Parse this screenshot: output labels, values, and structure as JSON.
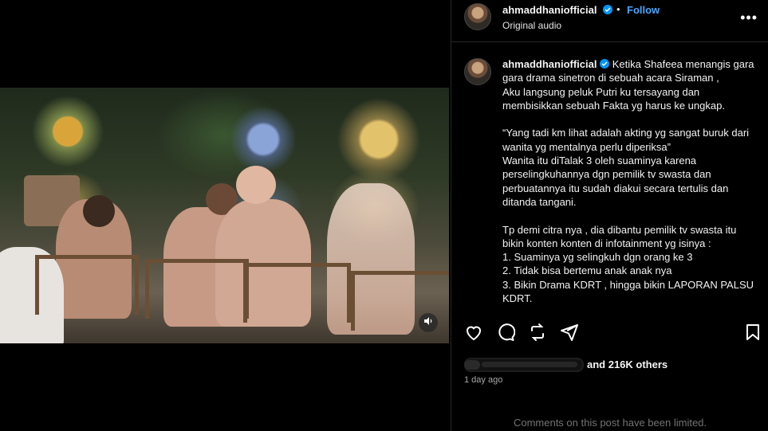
{
  "header": {
    "username": "ahmaddhaniofficial",
    "follow_label": "Follow",
    "audio_label": "Original audio",
    "more_icon": "more-horizontal-icon"
  },
  "caption": {
    "username": "ahmaddhaniofficial",
    "text": "Ketika Shafeea menangis gara gara drama sinetron di sebuah acara Siraman ,\nAku langsung peluk Putri ku tersayang dan membisikkan sebuah Fakta yg harus ke ungkap.\n\n“Yang tadi km lihat adalah akting yg sangat buruk dari wanita yg mentalnya perlu diperiksa”\nWanita itu diTalak 3 oleh suaminya karena perselingkuhannya dgn pemilik tv swasta dan perbuatannya itu sudah diakui secara tertulis dan ditanda tangani.\n\nTp demi citra nya , dia dibantu pemilik tv swasta itu bikin konten konten di infotainment yg isinya :\n1. Suaminya yg selingkuh dgn orang ke 3\n2. Tidak bisa bertemu anak anak nya\n3. Bikin Drama KDRT , hingga bikin LAPORAN PALSU KDRT."
  },
  "actions": {
    "like_icon": "heart-icon",
    "comment_icon": "comment-icon",
    "repost_icon": "repost-icon",
    "share_icon": "send-icon",
    "save_icon": "bookmark-icon"
  },
  "likes": {
    "suffix": "and 216K others"
  },
  "timestamp": "1 day ago",
  "comments_notice": "Comments on this post have been limited.",
  "media": {
    "volume_icon": "volume-icon"
  },
  "colors": {
    "accent": "#0095f6",
    "follow": "#4aa6ff",
    "background": "#000000",
    "muted_text": "#737373"
  }
}
